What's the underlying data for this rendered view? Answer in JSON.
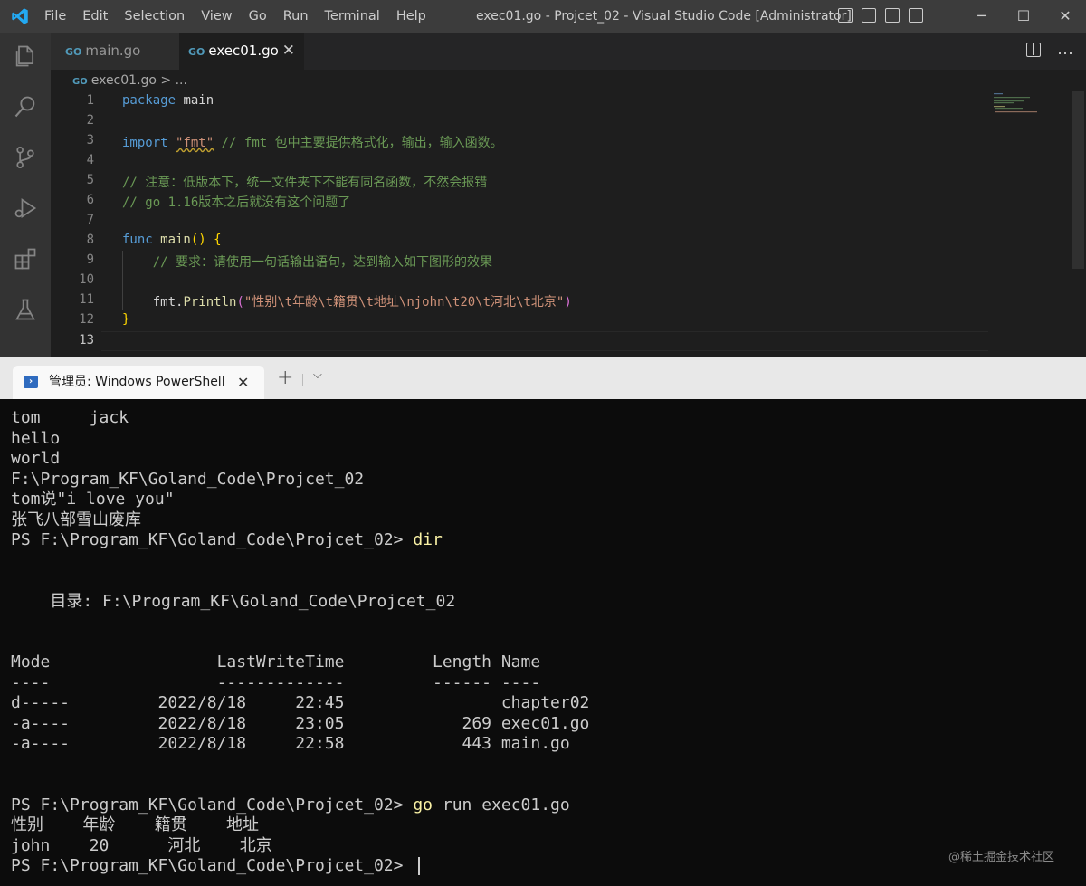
{
  "vscode": {
    "menu": [
      "File",
      "Edit",
      "Selection",
      "View",
      "Go",
      "Run",
      "Terminal",
      "Help"
    ],
    "window_title": "exec01.go - Projcet_02 - Visual Studio Code [Administrator]",
    "tabs": [
      {
        "label": "main.go",
        "icon": "go-file-icon",
        "active": false
      },
      {
        "label": "exec01.go",
        "icon": "go-file-icon",
        "active": true
      }
    ],
    "tab_close": "✕",
    "breadcrumb": {
      "file": "exec01.go",
      "sep": ">",
      "rest": "..."
    },
    "activity_icons": [
      "explorer-icon",
      "search-icon",
      "source-control-icon",
      "run-debug-icon",
      "extensions-icon",
      "testing-icon"
    ],
    "line_numbers": [
      "1",
      "2",
      "3",
      "4",
      "5",
      "6",
      "7",
      "8",
      "9",
      "10",
      "11",
      "12",
      "13"
    ],
    "code": {
      "l1_kw": "package",
      "l1_id": " main",
      "l3_kw": "import",
      "l3_str": "\"fmt\"",
      "l3_cm": " // fmt 包中主要提供格式化，输出，输入函数。",
      "l5_cm": "// 注意：低版本下，统一文件夹下不能有同名函数，不然会报错",
      "l6_cm": "// go 1.16版本之后就没有这个问题了",
      "l8_kw": "func",
      "l8_fn": " main",
      "l8_br": "() {",
      "l9_cm": "    // 要求：请使用一句话输出语句，达到输入如下图形的效果",
      "l11_pre": "    fmt.",
      "l11_fn": "Println",
      "l11_br1": "(",
      "l11_str": "\"性别\\t年龄\\t籍贯\\t地址\\njohn\\t20\\t河北\\t北京\"",
      "l11_br2": ")",
      "l12_br": "}"
    }
  },
  "terminal": {
    "tab_title": "管理员: Windows PowerShell",
    "tab_close": "✕",
    "new_tab": "+",
    "dropdown": "⌵",
    "lines": [
      "tom     jack",
      "hello",
      "world",
      "F:\\Program_KF\\Goland_Code\\Projcet_02",
      "tom说\"i love you\"",
      "张飞八部雪山废库",
      "",
      "",
      "",
      "    目录: F:\\Program_KF\\Goland_Code\\Projcet_02",
      "",
      "",
      "Mode                 LastWriteTime         Length Name",
      "----                 -------------         ------ ----",
      "d-----         2022/8/18     22:45                chapter02",
      "-a----         2022/8/18     23:05            269 exec01.go",
      "-a----         2022/8/18     22:58            443 main.go",
      "",
      "",
      "",
      "性别    年龄    籍贯    地址",
      "john    20      河北    北京",
      ""
    ],
    "prompt": "PS F:\\Program_KF\\Goland_Code\\Projcet_02> ",
    "cmd_dir": "dir",
    "cmd_go": "go",
    "cmd_go_args": " run exec01.go",
    "watermark": "@稀土掘金技术社区"
  }
}
